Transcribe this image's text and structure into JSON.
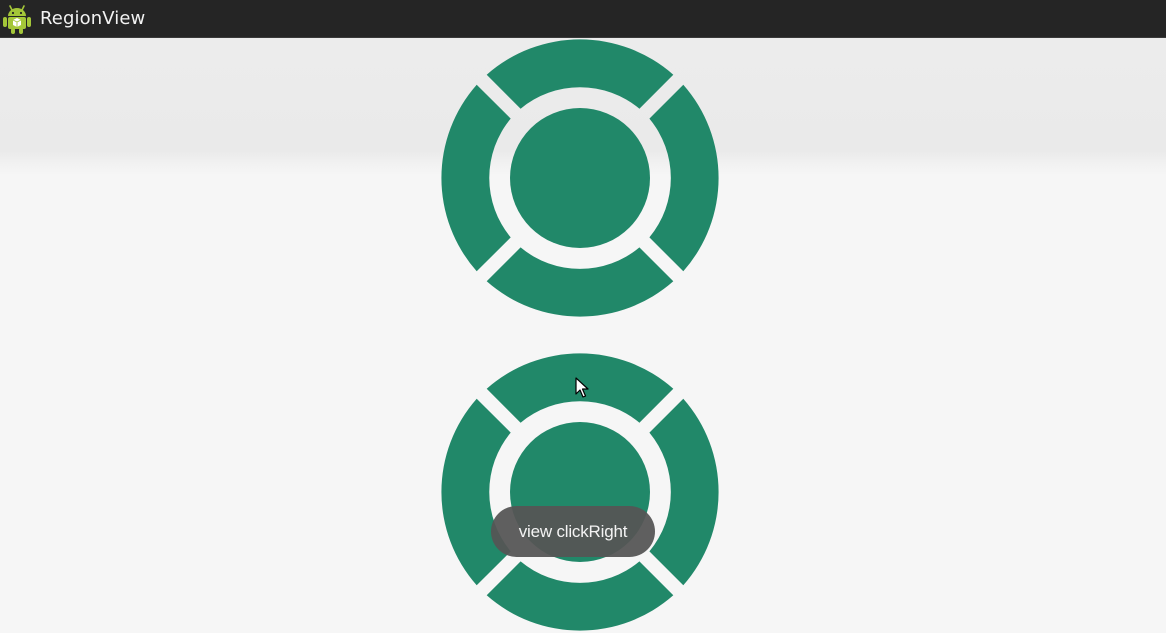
{
  "app": {
    "title": "RegionView",
    "icon": "android-robot-icon"
  },
  "colors": {
    "action_bar": "#252525",
    "region_fill": "#218869",
    "background": "#f6f6f6",
    "toast_background": "#555555"
  },
  "region_views": [
    {
      "segments": [
        "top",
        "right",
        "bottom",
        "left",
        "center"
      ]
    },
    {
      "segments": [
        "top",
        "right",
        "bottom",
        "left",
        "center"
      ]
    }
  ],
  "toast": {
    "message": "view clickRight"
  }
}
